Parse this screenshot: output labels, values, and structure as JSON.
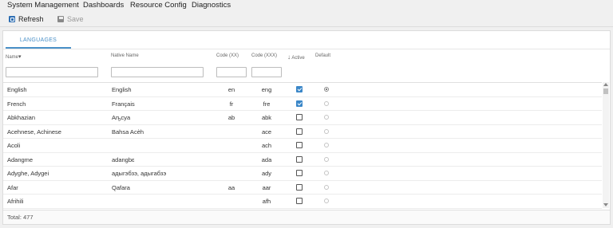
{
  "menu": [
    "System Management",
    "Dashboards",
    "Resource Config",
    "Diagnostics"
  ],
  "toolbar": {
    "refresh_label": "Refresh",
    "save_label": "Save"
  },
  "tab": {
    "label": "LANGUAGES"
  },
  "columns": {
    "name": "Name",
    "name_sort": "▾",
    "native": "Native Name",
    "code2": "Code (XX)",
    "code3": "Code (XXX)",
    "active_arrow": "↓",
    "active": "Active",
    "default": "Default"
  },
  "filters": {
    "name": "",
    "native": "",
    "code2": "",
    "code3": ""
  },
  "rows": [
    {
      "name": "English",
      "native": "English",
      "code2": "en",
      "code3": "eng",
      "active": true,
      "default": true
    },
    {
      "name": "French",
      "native": "Français",
      "code2": "fr",
      "code3": "fre",
      "active": true,
      "default": false
    },
    {
      "name": "Abkhazian",
      "native": "Аҧсуа",
      "code2": "ab",
      "code3": "abk",
      "active": false,
      "default": false
    },
    {
      "name": "Acehnese, Achinese",
      "native": "Bahsa Acèh",
      "code2": "",
      "code3": "ace",
      "active": false,
      "default": false
    },
    {
      "name": "Acoli",
      "native": "",
      "code2": "",
      "code3": "ach",
      "active": false,
      "default": false
    },
    {
      "name": "Adangme",
      "native": "adangbɛ",
      "code2": "",
      "code3": "ada",
      "active": false,
      "default": false
    },
    {
      "name": "Adyghe, Adygei",
      "native": "адыгэбзэ, адыгабзэ",
      "code2": "",
      "code3": "ady",
      "active": false,
      "default": false
    },
    {
      "name": "Afar",
      "native": "Qafara",
      "code2": "aa",
      "code3": "aar",
      "active": false,
      "default": false
    },
    {
      "name": "Afrihili",
      "native": "",
      "code2": "",
      "code3": "afh",
      "active": false,
      "default": false
    }
  ],
  "footer": {
    "total": "Total: 477"
  }
}
